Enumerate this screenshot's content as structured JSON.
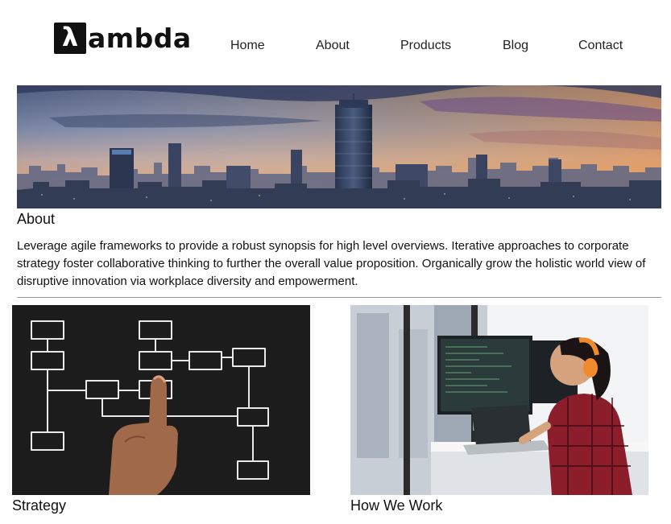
{
  "header": {
    "logo_glyph": "λ",
    "logo_text": "ambda",
    "nav": [
      "Home",
      "About",
      "Products",
      "Blog",
      "Contact"
    ]
  },
  "about": {
    "title": "About",
    "body": "Leverage agile frameworks to provide a robust synopsis for high level overviews. Iterative approaches to corporate strategy foster collaborative thinking to further the overall value proposition. Organically grow the holistic world view of disruptive innovation via workplace diversity and empowerment."
  },
  "cards": [
    {
      "caption": "Strategy"
    },
    {
      "caption": "How We Work"
    }
  ],
  "colors": {
    "text": "#1a1a1a",
    "divider": "#9a9a9a",
    "logo": "#111111"
  }
}
